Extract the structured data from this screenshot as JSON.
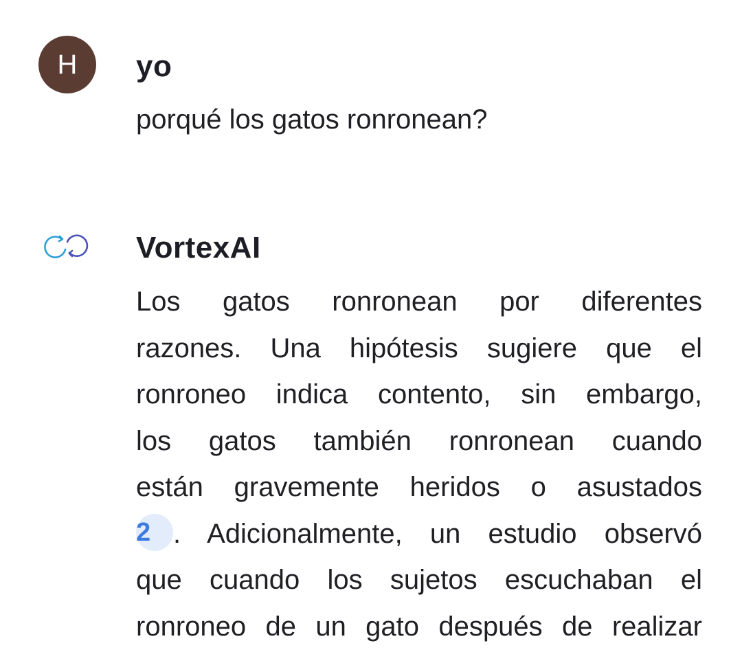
{
  "conversation": {
    "user": {
      "avatar_letter": "H",
      "avatar_color": "#5b3c33",
      "name": "yo",
      "message": "porqué los gatos ronronean?"
    },
    "assistant": {
      "logo_icon": "vortex-loop-icon",
      "logo_colors": [
        "#2a9fd6",
        "#4a52b8"
      ],
      "name": "VortexAI",
      "lines": [
        "Los gatos ronronean por diferentes",
        "razones. Una hipótesis sugiere que el",
        "ronroneo indica contento, sin embargo,",
        "los gatos también ronronean cuando",
        "están gravemente heridos o asustados"
      ],
      "citation_number": "2",
      "line_after_citation": ". Adicionalmente, un estudio observó",
      "lines_after": [
        "que cuando los sujetos escuchaban el",
        "ronroneo de un gato después de realizar"
      ],
      "citation_color": "#3e7be0"
    }
  }
}
